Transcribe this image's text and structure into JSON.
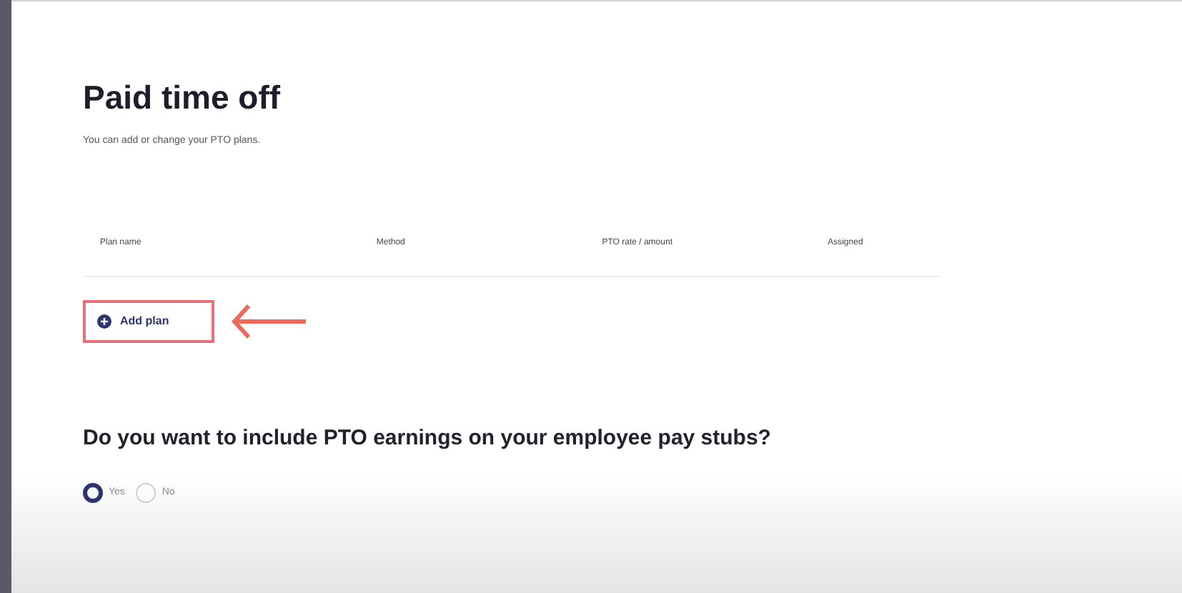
{
  "page": {
    "title": "Paid time off",
    "subtitle": "You can add or change your PTO plans."
  },
  "table": {
    "columns": [
      "Plan name",
      "Method",
      "PTO rate / amount",
      "Assigned"
    ]
  },
  "add_button": {
    "label": "Add plan",
    "highlighted": true
  },
  "question": {
    "text": "Do you want to include PTO earnings on your employee pay stubs?",
    "options": [
      {
        "label": "Yes",
        "selected": true
      },
      {
        "label": "No",
        "selected": false
      }
    ]
  }
}
